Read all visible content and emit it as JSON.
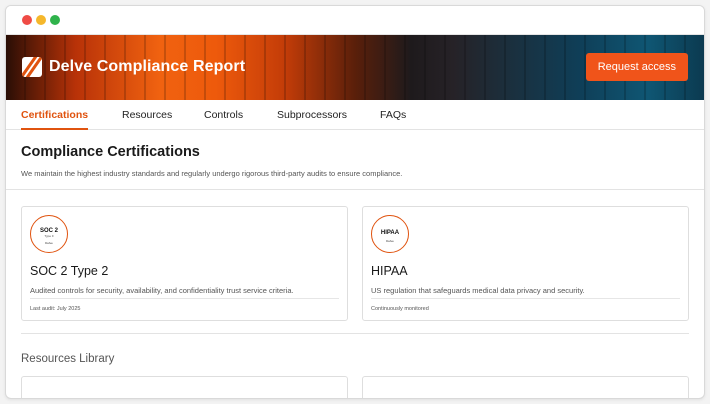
{
  "window": {
    "controls": [
      "close",
      "minimize",
      "maximize"
    ]
  },
  "header": {
    "title": "Delve Compliance Report",
    "logo_icon": "delve-logo-icon",
    "request_button": "Request access",
    "accent_color": "#f0541a"
  },
  "tabs": [
    {
      "label": "Certifications",
      "active": true
    },
    {
      "label": "Resources",
      "active": false
    },
    {
      "label": "Controls",
      "active": false
    },
    {
      "label": "Subprocessors",
      "active": false
    },
    {
      "label": "FAQs",
      "active": false
    }
  ],
  "certifications": {
    "title": "Compliance Certifications",
    "description": "We maintain the highest industry standards and regularly undergo rigorous third-party audits to ensure compliance.",
    "cards": [
      {
        "badge_main": "SOC 2",
        "badge_sub": "Type II",
        "badge_brand": "Delve",
        "title": "SOC 2 Type 2",
        "description": "Audited controls for security, availability, and confidentiality trust service criteria.",
        "meta": "Last audit: July 2025"
      },
      {
        "badge_main": "HIPAA",
        "badge_sub": "",
        "badge_brand": "Delve",
        "title": "HIPAA",
        "description": "US regulation that safeguards medical data privacy and security.",
        "meta": "Continuously monitored"
      }
    ]
  },
  "resources": {
    "title": "Resources Library"
  }
}
